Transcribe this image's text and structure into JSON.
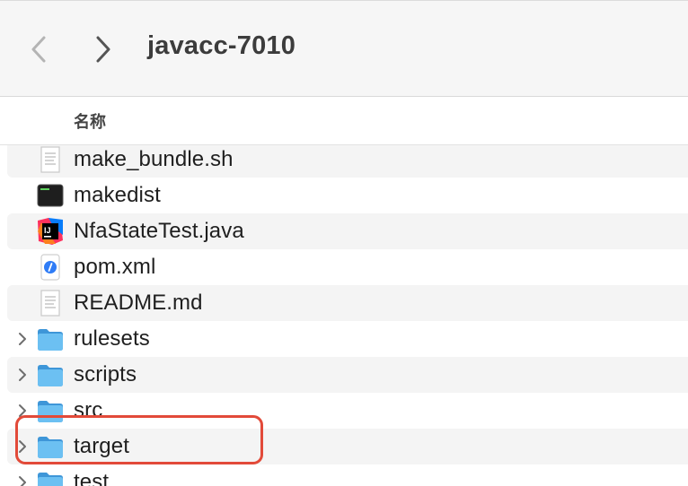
{
  "window": {
    "title": "javacc-7010"
  },
  "toolbar": {
    "back_icon": "chevron-left-icon",
    "forward_icon": "chevron-right-icon"
  },
  "columns": {
    "name": "名称"
  },
  "files": [
    {
      "name": "make_bundle.sh",
      "kind": "text",
      "icon": "text-document-icon",
      "folder": false
    },
    {
      "name": "makedist",
      "kind": "exec",
      "icon": "terminal-exec-icon",
      "folder": false
    },
    {
      "name": "NfaStateTest.java",
      "kind": "java",
      "icon": "intellij-java-icon",
      "folder": false
    },
    {
      "name": "pom.xml",
      "kind": "xml",
      "icon": "xml-document-icon",
      "folder": false
    },
    {
      "name": "README.md",
      "kind": "text",
      "icon": "text-document-icon",
      "folder": false
    },
    {
      "name": "rulesets",
      "kind": "folder",
      "icon": "folder-icon",
      "folder": true
    },
    {
      "name": "scripts",
      "kind": "folder",
      "icon": "folder-icon",
      "folder": true
    },
    {
      "name": "src",
      "kind": "folder",
      "icon": "folder-icon",
      "folder": true
    },
    {
      "name": "target",
      "kind": "folder",
      "icon": "folder-icon",
      "folder": true,
      "highlighted": true
    },
    {
      "name": "test",
      "kind": "folder",
      "icon": "folder-icon",
      "folder": true
    }
  ],
  "colors": {
    "toolbar_bg": "#f6f6f6",
    "row_stripe": "#f4f4f4",
    "folder_blue": "#5ab0ea",
    "highlight_red": "#e24a39"
  }
}
